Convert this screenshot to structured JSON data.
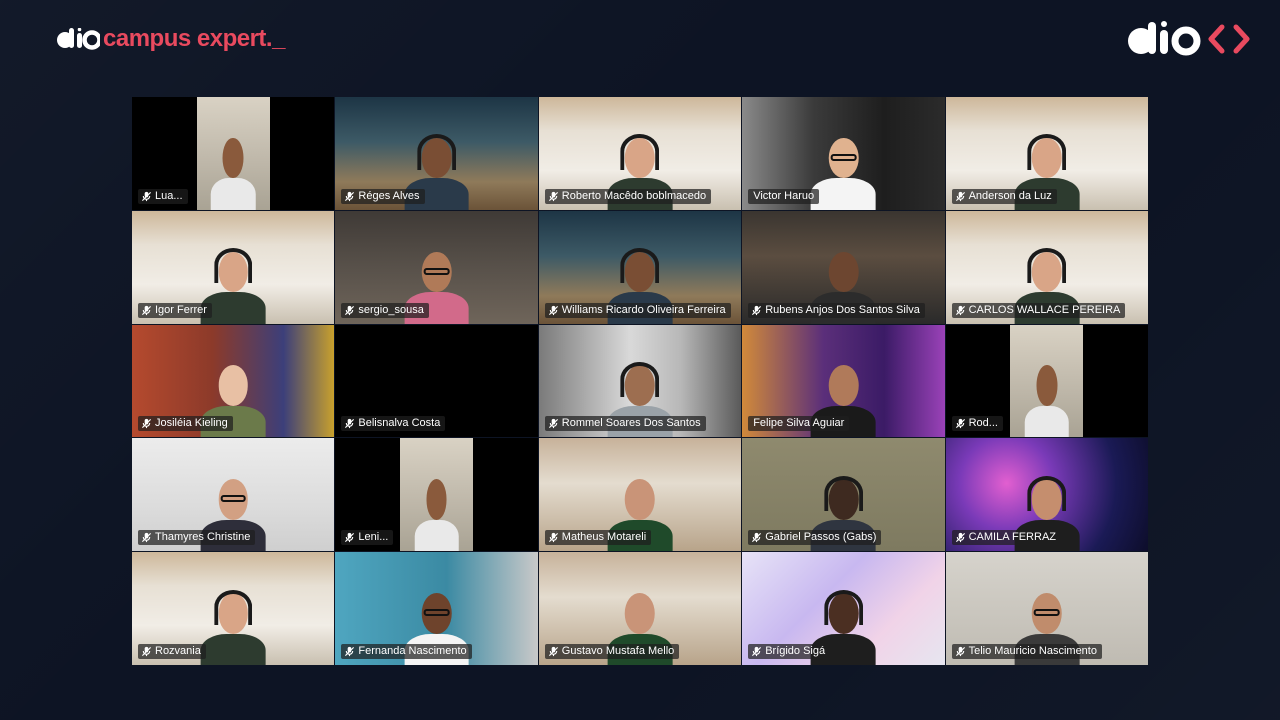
{
  "branding": {
    "left_text": "campus expert._",
    "left_logo": "dio-logo",
    "right_logo": "dio-logo-code-brackets"
  },
  "colors": {
    "background": "#0d1424",
    "brand_red": "#e94a5f",
    "brand_white": "#ffffff",
    "name_tag_bg": "rgba(30,30,30,0.72)"
  },
  "participants": [
    {
      "name": "Lua...",
      "muted": true,
      "scene": "room-pillar"
    },
    {
      "name": "Réges Alves",
      "muted": true,
      "scene": "space-desert"
    },
    {
      "name": "Roberto Macêdo boblmacedo",
      "muted": true,
      "scene": "loft"
    },
    {
      "name": "Victor Haruo",
      "muted": false,
      "scene": "office-dark"
    },
    {
      "name": "Anderson da Luz",
      "muted": true,
      "scene": "loft"
    },
    {
      "name": "Igor Ferrer",
      "muted": true,
      "scene": "loft"
    },
    {
      "name": "sergio_sousa",
      "muted": true,
      "scene": "home-tv"
    },
    {
      "name": "Williams Ricardo Oliveira Ferreira",
      "muted": true,
      "scene": "space-desert"
    },
    {
      "name": "Rubens Anjos Dos Santos Silva",
      "muted": true,
      "scene": "newsroom"
    },
    {
      "name": "CARLOS WALLACE PEREIRA",
      "muted": true,
      "scene": "loft"
    },
    {
      "name": "Josiléia Kieling",
      "muted": true,
      "scene": "colorful-room"
    },
    {
      "name": "Belisnalva Costa",
      "muted": true,
      "scene": "camera-off"
    },
    {
      "name": "Rommel Soares Dos Santos",
      "muted": true,
      "scene": "loft-city"
    },
    {
      "name": "Felipe Silva Aguiar",
      "muted": false,
      "scene": "gamer-purple"
    },
    {
      "name": "Rod...",
      "muted": true,
      "scene": "room-pillar"
    },
    {
      "name": "Thamyres Christine",
      "muted": true,
      "scene": "white-room"
    },
    {
      "name": "Leni...",
      "muted": true,
      "scene": "room-pillar"
    },
    {
      "name": "Matheus Motareli",
      "muted": true,
      "scene": "living-room"
    },
    {
      "name": "Gabriel Passos (Gabs)",
      "muted": true,
      "scene": "plain-wall"
    },
    {
      "name": "CAMILA FERRAZ",
      "muted": true,
      "scene": "nebula"
    },
    {
      "name": "Rozvania",
      "muted": true,
      "scene": "loft"
    },
    {
      "name": "Fernanda Nascimento",
      "muted": true,
      "scene": "teal-wall"
    },
    {
      "name": "Gustavo Mustafa Mello",
      "muted": true,
      "scene": "living-room"
    },
    {
      "name": "Brígido Sigá",
      "muted": true,
      "scene": "ribbons"
    },
    {
      "name": "Telio Mauricio Nascimento",
      "muted": true,
      "scene": "grey-room"
    }
  ]
}
